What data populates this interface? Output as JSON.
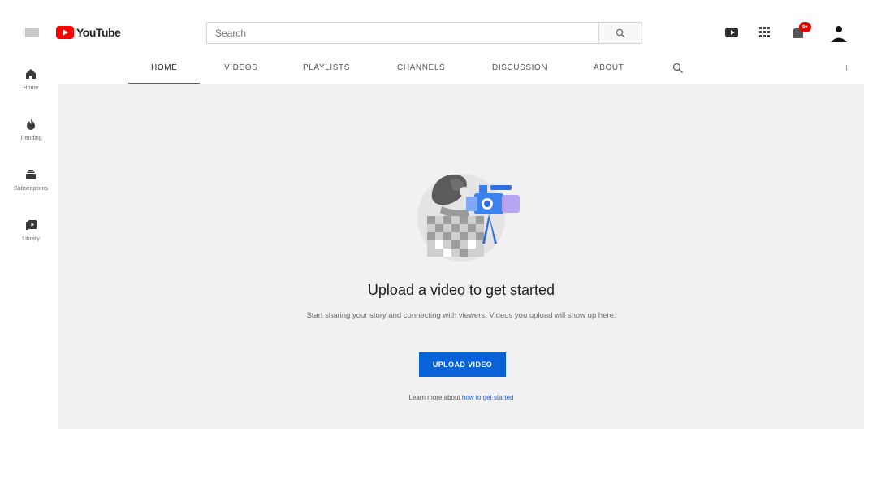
{
  "header": {
    "logo_text": "YouTube",
    "search_placeholder": "Search",
    "notification_count": "9+"
  },
  "sidebar": {
    "items": [
      {
        "label": "Home",
        "icon": "home-icon"
      },
      {
        "label": "Trending",
        "icon": "trending-icon"
      },
      {
        "label": "Subscriptions",
        "icon": "subscriptions-icon"
      },
      {
        "label": "Library",
        "icon": "library-icon"
      }
    ]
  },
  "tabs": [
    {
      "label": "Home"
    },
    {
      "label": "Videos"
    },
    {
      "label": "Playlists"
    },
    {
      "label": "Channels"
    },
    {
      "label": "Discussion"
    },
    {
      "label": "About"
    }
  ],
  "empty_state": {
    "headline": "Upload a video to get started",
    "description": "Start sharing your story and connecting with viewers. Videos you upload will show up here.",
    "upload_button": "Upload video",
    "learn_prefix": "Learn more about",
    "learn_link": "how to get started"
  },
  "colors": {
    "brand_red": "#ff0000",
    "accent_blue": "#0a62d9",
    "content_bg": "#f1f1f1"
  }
}
